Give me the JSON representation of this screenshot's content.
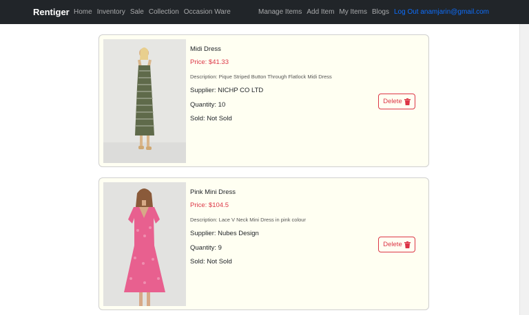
{
  "navbar": {
    "brand": "Rentiger",
    "left_links": [
      "Home",
      "Inventory",
      "Sale",
      "Collection",
      "Occasion Ware"
    ],
    "right_links": [
      "Manage Items",
      "Add Item",
      "My Items",
      "Blogs"
    ],
    "logout": "Log Out anamjarin@gmail.com"
  },
  "items": [
    {
      "name": "Midi Dress",
      "price": "Price: $41.33",
      "description": "Description: Pique Striped Button Through Flatlock Midi Dress",
      "supplier": "Supplier: NICHP CO LTD",
      "quantity": "Quantity: 10",
      "sold": "Sold: Not Sold",
      "delete_label": "Delete",
      "dress_color": "#5f6a4a"
    },
    {
      "name": "Pink Mini Dress",
      "price": "Price: $104.5",
      "description": "Description: Lace V Neck Mini Dress in pink colour",
      "supplier": "Supplier: Nubes Design",
      "quantity": "Quantity: 9",
      "sold": "Sold: Not Sold",
      "delete_label": "Delete",
      "dress_color": "#e8608f"
    }
  ],
  "colors": {
    "navbar": "#212529",
    "danger": "#dc3545",
    "link": "#0d6efd",
    "card_bg": "#fffff2"
  }
}
